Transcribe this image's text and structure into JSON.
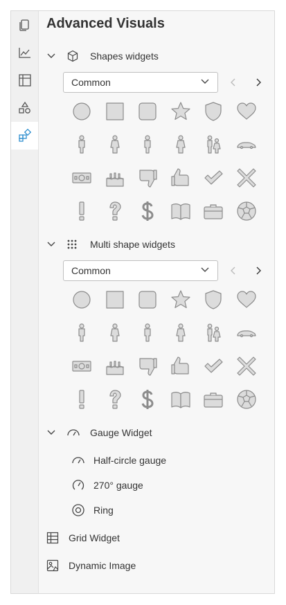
{
  "panel_title": "Advanced Visuals",
  "rail": {
    "items": [
      {
        "name": "pages-icon"
      },
      {
        "name": "line-chart-icon"
      },
      {
        "name": "table-icon"
      },
      {
        "name": "shapes-icon"
      },
      {
        "name": "widgets-icon",
        "active": true
      }
    ]
  },
  "shapes_section": {
    "label": "Shapes widgets",
    "select_value": "Common"
  },
  "multi_section": {
    "label": "Multi shape widgets",
    "select_value": "Common"
  },
  "gauge_section": {
    "label": "Gauge Widget",
    "items": [
      {
        "label": "Half-circle gauge"
      },
      {
        "label": "270° gauge"
      },
      {
        "label": "Ring"
      }
    ]
  },
  "grid_widget": {
    "label": "Grid Widget"
  },
  "dynamic_image": {
    "label": "Dynamic Image"
  },
  "shape_names": [
    "circle-icon",
    "square-icon",
    "rounded-square-icon",
    "star-icon",
    "shield-icon",
    "heart-icon",
    "man-icon",
    "woman-icon",
    "man-alt-icon",
    "woman-alt-icon",
    "family-icon",
    "car-icon",
    "money-icon",
    "cake-icon",
    "thumbs-down-icon",
    "thumbs-up-icon",
    "checkmark-icon",
    "cross-icon",
    "exclamation-icon",
    "question-icon",
    "dollar-icon",
    "book-icon",
    "briefcase-icon",
    "soccer-ball-icon"
  ],
  "colors": {
    "shape_fill": "#dcdcdc",
    "shape_stroke": "#8c8c8c",
    "accent": "#2f8fcf"
  }
}
